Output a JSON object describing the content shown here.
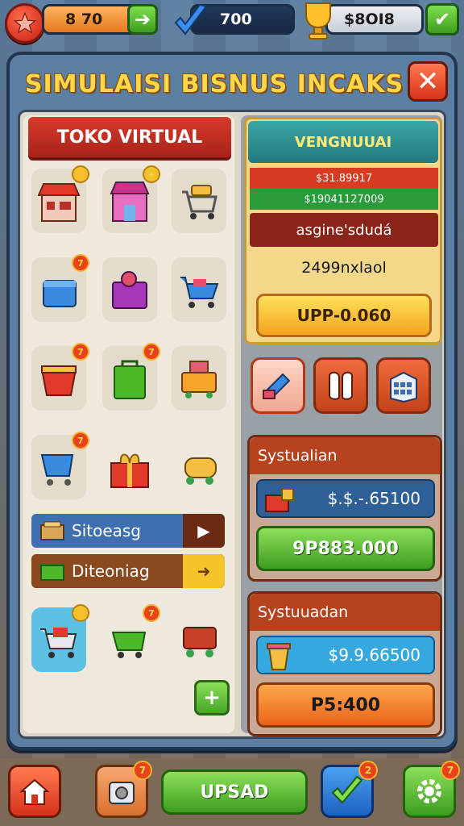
{
  "topbar": {
    "coins": "8  70",
    "score": "700",
    "money": "$8OI8"
  },
  "panel": {
    "title": "SIMULAISI BISNUS INCAKS",
    "close": "✕"
  },
  "shop": {
    "header": "TOKO VIRTUAL",
    "badges": [
      "",
      "",
      "",
      "",
      "",
      "",
      "",
      "",
      "",
      "",
      "",
      ""
    ],
    "row1_label": "Sitoeasg",
    "row2_label": "Diteoniag",
    "add": "+"
  },
  "vendor": {
    "header": "VENGNUUAI",
    "line_red": "$31.89917",
    "line_green": "$19041127009",
    "line_dark": "asgine'sdudá",
    "line_plain": "2499nxlaol",
    "button": "UPP-0.060"
  },
  "system1": {
    "title": "Systualian",
    "value": "$.$.-.65100",
    "button": "9P883.000"
  },
  "system2": {
    "title": "Systuuadan",
    "value": "$9.9.66500",
    "button": "P5:400"
  },
  "bottombar": {
    "main_button": "UPSAD",
    "badge_left": "7",
    "badge_check": "2",
    "badge_gear": "7"
  },
  "colors": {
    "accent": "#ffd84a",
    "danger": "#d7321a",
    "success": "#46a625"
  }
}
